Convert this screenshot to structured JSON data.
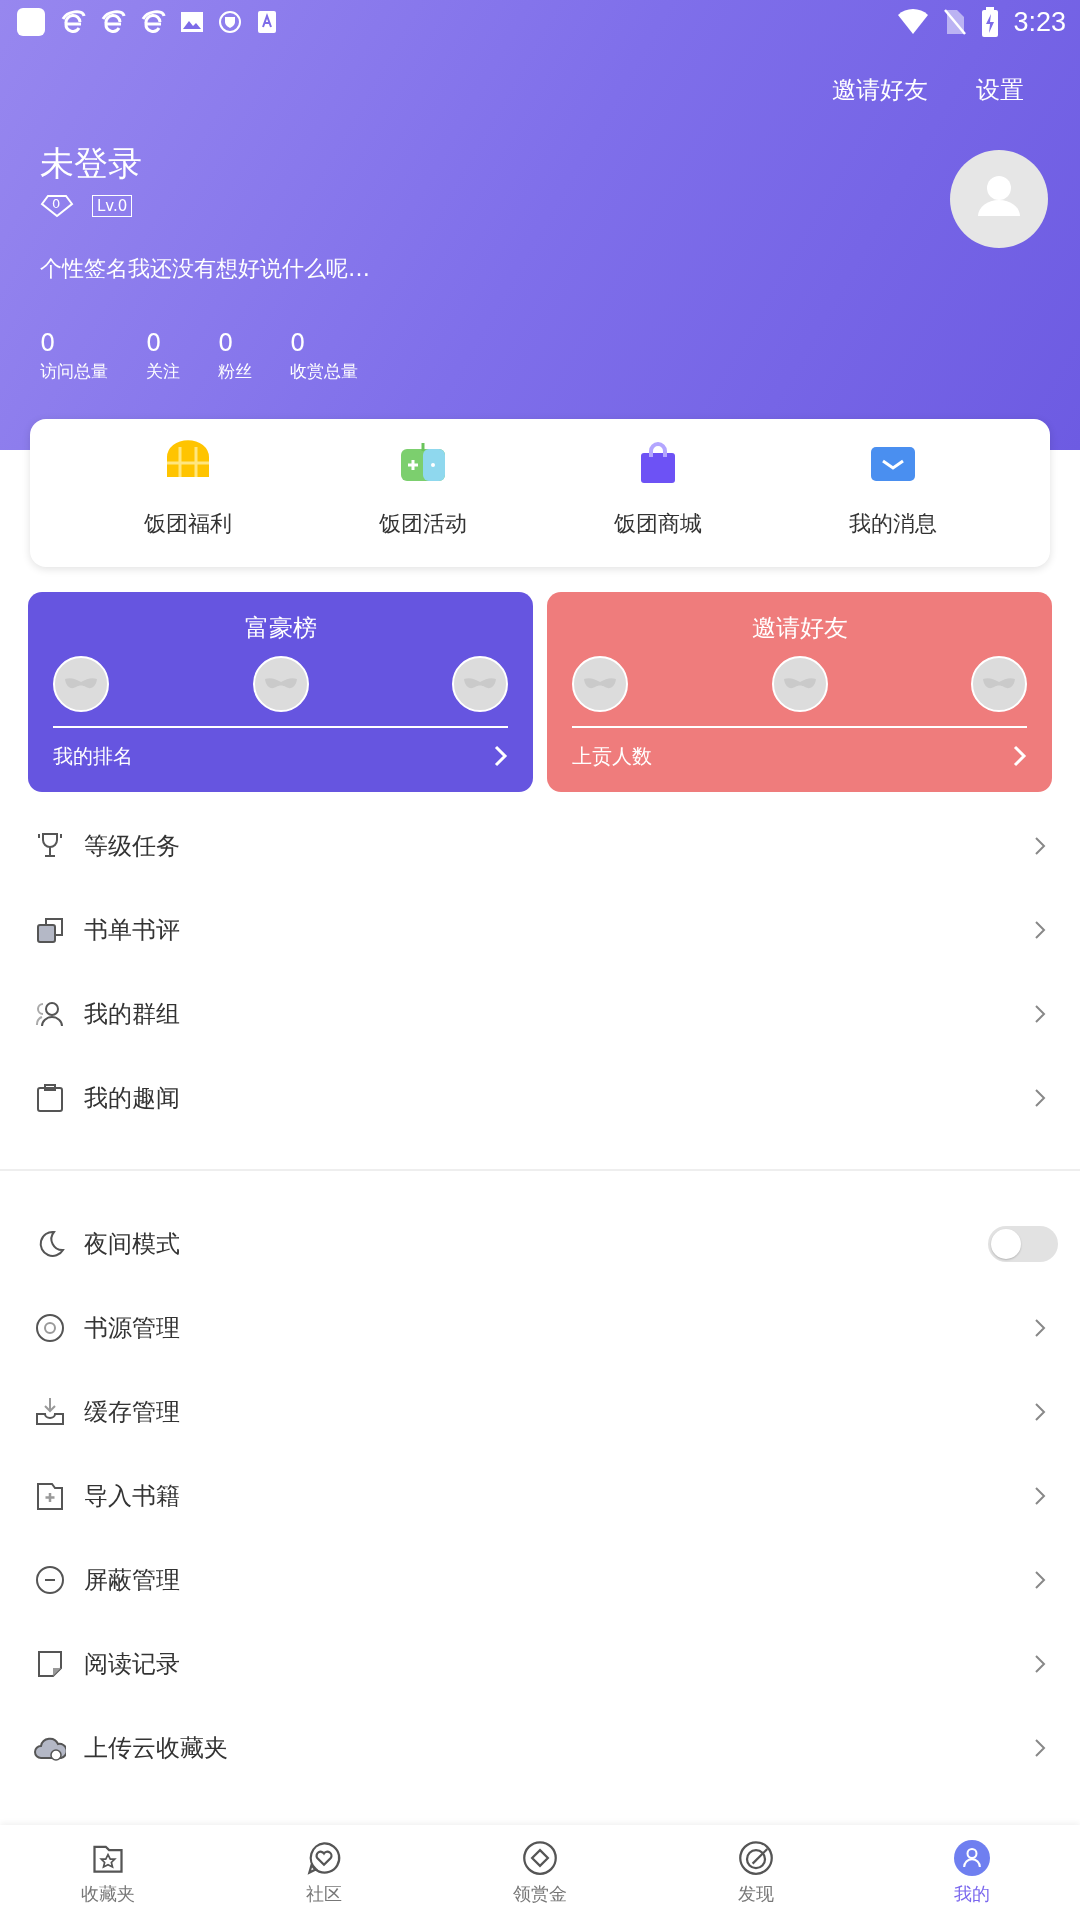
{
  "status_bar": {
    "time": "3:23"
  },
  "header": {
    "actions": [
      {
        "label": "邀请好友"
      },
      {
        "label": "设置"
      }
    ],
    "username": "未登录",
    "gems": "0",
    "level": "Lv.0",
    "signature": "个性签名我还没有想好说什么呢…",
    "stats": [
      {
        "value": "0",
        "label": "访问总量"
      },
      {
        "value": "0",
        "label": "关注"
      },
      {
        "value": "0",
        "label": "粉丝"
      },
      {
        "value": "0",
        "label": "收赏总量"
      }
    ]
  },
  "shortcuts": [
    {
      "label": "饭团福利"
    },
    {
      "label": "饭团活动"
    },
    {
      "label": "饭团商城"
    },
    {
      "label": "我的消息"
    }
  ],
  "boards": [
    {
      "title": "富豪榜",
      "footer": "我的排名",
      "color": "#6655e0"
    },
    {
      "title": "邀请好友",
      "footer": "上贡人数",
      "color": "#ef7c7c"
    }
  ],
  "menu_groups": [
    [
      {
        "label": "等级任务",
        "kind": "link"
      },
      {
        "label": "书单书评",
        "kind": "link"
      },
      {
        "label": "我的群组",
        "kind": "link"
      },
      {
        "label": "我的趣闻",
        "kind": "link"
      }
    ],
    [
      {
        "label": "夜间模式",
        "kind": "toggle",
        "on": false
      },
      {
        "label": "书源管理",
        "kind": "link"
      },
      {
        "label": "缓存管理",
        "kind": "link"
      },
      {
        "label": "导入书籍",
        "kind": "link"
      },
      {
        "label": "屏蔽管理",
        "kind": "link"
      },
      {
        "label": "阅读记录",
        "kind": "link"
      },
      {
        "label": "上传云收藏夹",
        "kind": "link"
      }
    ]
  ],
  "nav": [
    {
      "label": "收藏夹",
      "selected": false
    },
    {
      "label": "社区",
      "selected": false
    },
    {
      "label": "领赏金",
      "selected": false
    },
    {
      "label": "发现",
      "selected": false
    },
    {
      "label": "我的",
      "selected": true
    }
  ]
}
